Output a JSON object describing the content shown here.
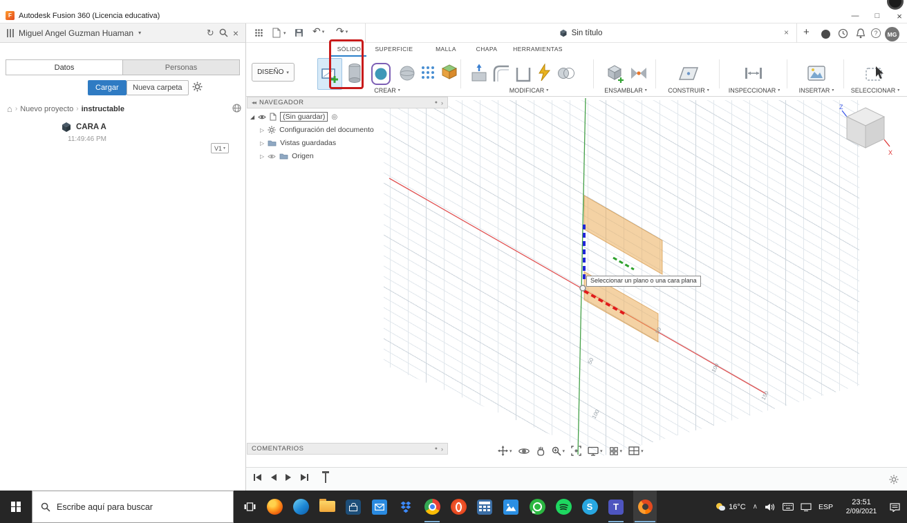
{
  "window": {
    "title": "Autodesk Fusion 360 (Licencia educativa)"
  },
  "account_bar": {
    "user_name": "Miguel Angel Guzman Huaman"
  },
  "data_panel": {
    "tab_datos": "Datos",
    "tab_personas": "Personas",
    "upload_button": "Cargar",
    "new_folder_button": "Nueva carpeta",
    "breadcrumb_project": "Nuevo proyecto",
    "breadcrumb_folder": "instructable",
    "item_name": "CARA A",
    "item_time": "11:49:46 PM",
    "item_version": "V1"
  },
  "toolbar": {
    "document_tab": "Sin título",
    "avatar_initials": "MG"
  },
  "ribbon": {
    "workspace": "DISEÑO",
    "tab_solido": "SÓLIDO",
    "tab_superficie": "SUPERFICIE",
    "tab_malla": "MALLA",
    "tab_chapa": "CHAPA",
    "tab_herramientas": "HERRAMIENTAS",
    "group_crear": "CREAR",
    "group_modificar": "MODIFICAR",
    "group_ensamblar": "ENSAMBLAR",
    "group_construir": "CONSTRUIR",
    "group_inspeccionar": "INSPECCIONAR",
    "group_insertar": "INSERTAR",
    "group_seleccionar": "SELECCIONAR"
  },
  "browser": {
    "title": "NAVEGADOR",
    "root": "(Sin guardar)",
    "node_config": "Configuración del documento",
    "node_views": "Vistas guardadas",
    "node_origin": "Origen"
  },
  "comments": {
    "title": "COMENTARIOS"
  },
  "canvas": {
    "tooltip": "Seleccionar un plano o una cara plana",
    "tick_r1": "50",
    "tick_r2": "100",
    "tick_r3": "150",
    "tick_g1": "50",
    "tick_g2": "100",
    "viewcube_z": "Z",
    "viewcube_x": "X"
  },
  "taskbar": {
    "search_placeholder": "Escribe aquí para buscar",
    "weather": "16°C",
    "language": "ESP",
    "time": "23:51",
    "date": "2/09/2021",
    "app_icons": [
      "firefox",
      "edge",
      "file-explorer",
      "store",
      "mail",
      "dropbox",
      "chrome",
      "opera",
      "calculator",
      "photos",
      "whatsapp",
      "spotify",
      "skype",
      "teams",
      "fusion-360"
    ],
    "active_apps": [
      "chrome",
      "teams",
      "fusion-360"
    ]
  },
  "glyphs": {
    "chevron_down": "▾",
    "refresh": "↻",
    "close": "×",
    "minimize": "—",
    "maximize": "□",
    "undo": "↶",
    "redo": "↷",
    "plus": "+",
    "question": "?",
    "home": "⌂",
    "crumb_sep": "›",
    "expander_open": "◢",
    "expander_closed": "▷",
    "radio": "◎",
    "collapse": "◂◂",
    "dot": "●",
    "chevron_right": "›",
    "tray_chevron": "∧",
    "fusion_f": "F",
    "skype_s": "S",
    "teams_t": "T"
  }
}
